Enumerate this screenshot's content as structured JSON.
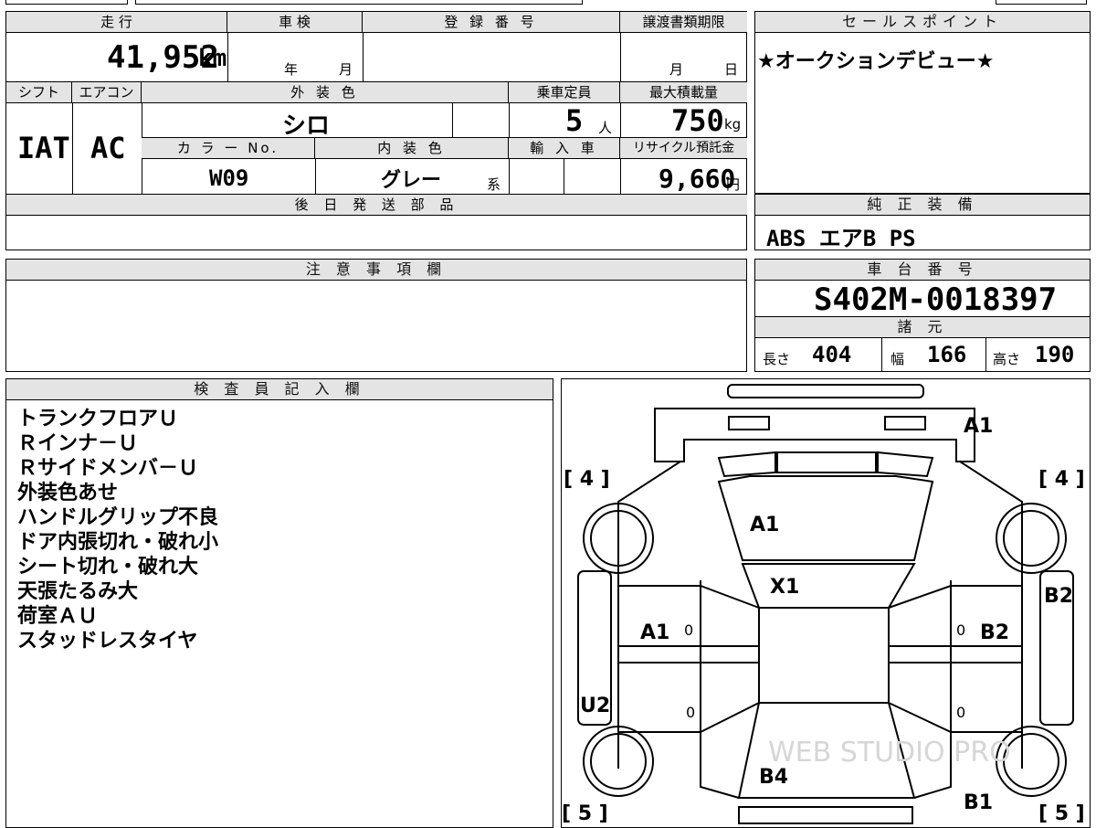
{
  "top": {
    "mileage_label": "走 行",
    "mileage": "41,952",
    "mileage_unit": "km",
    "inspection_label": "車 検",
    "year_unit": "年",
    "month_unit": "月",
    "reg_label": "登 録 番 号",
    "transfer_label": "譲渡書類期限",
    "transfer_month": "月",
    "transfer_day": "日",
    "shift_label": "シフト",
    "shift": "IAT",
    "ac_label": "エアコン",
    "ac": "AC",
    "ext_color_label": "外 装 色",
    "ext_color": "シロ",
    "capacity_label": "乗車定員",
    "capacity": "5",
    "capacity_unit": "人",
    "max_load_label": "最大積載量",
    "max_load": "750",
    "max_load_unit": "kg",
    "color_no_label": "カ ラ ー No.",
    "color_no": "W09",
    "int_color_label": "内 装 色",
    "int_color": "グレー",
    "int_color_suffix": "系",
    "import_label": "輸 入 車",
    "recycle_label": "リサイクル預託金",
    "recycle": "9,660",
    "recycle_unit": "円",
    "later_parts_label": "後 日 発 送 部 品"
  },
  "sales": {
    "label": "セールスポイント",
    "text": "★オークションデビュー★"
  },
  "equipment": {
    "label": "純 正 装 備",
    "text": "ABS エアB PS"
  },
  "notes": {
    "label": "注 意 事 項 欄"
  },
  "chassis": {
    "label": "車 台 番 号",
    "number": "S402M-0018397",
    "spec_label": "諸 元",
    "length_label": "長さ",
    "length": "404",
    "width_label": "幅",
    "width": "166",
    "height_label": "高さ",
    "height": "190"
  },
  "inspector": {
    "label": "検 査 員 記 入 欄",
    "items": [
      "トランクフロアＵ",
      "Ｒインナ－Ｕ",
      "Ｒサイドメンバ－Ｕ",
      "外装色あせ",
      "ハンドルグリップ不良",
      "ドア内張切れ・破れ小",
      "シート切れ・破れ大",
      "天張たるみ大",
      "荷室ＡＵ",
      "スタッドレスタイヤ"
    ]
  },
  "diagram": {
    "tire_fl": "[ 4 ]",
    "tire_fr": "[ 4 ]",
    "tire_rl": "[ 5 ]",
    "tire_rr": "[ 5 ]",
    "roof_front": "A1",
    "hood": "A1",
    "roof": "X1",
    "left_door": "A1",
    "right_door": "B2",
    "right_side": "B2",
    "left_side": "U2",
    "rear_gate": "B4",
    "rear_right": "B1",
    "zero_1": "0",
    "zero_2": "0",
    "zero_3": "0",
    "zero_4": "0",
    "watermark": "WEB STUDIO PRO"
  }
}
